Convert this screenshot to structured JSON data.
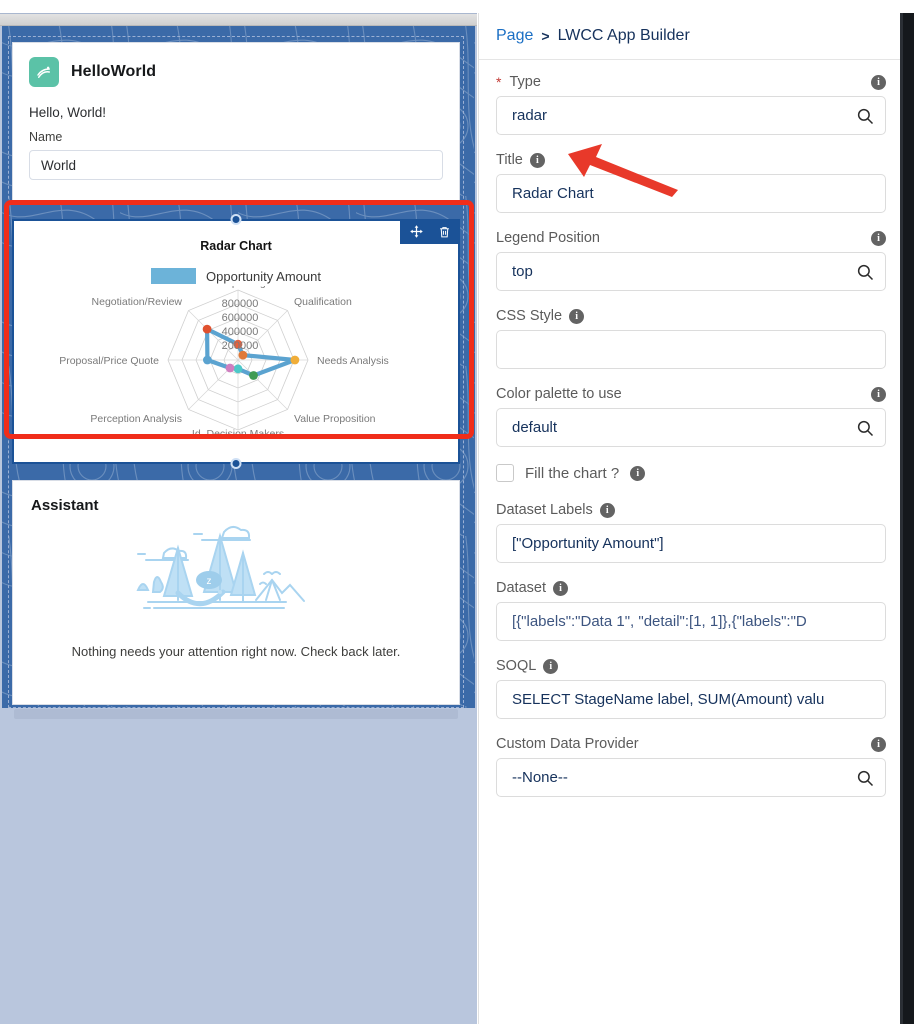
{
  "canvas": {
    "hello_card": {
      "icon": "lightning-component-icon",
      "title": "HelloWorld",
      "greeting": "Hello, World!",
      "field_label": "Name",
      "field_value": "World"
    },
    "chart_card": {
      "toolbar": {
        "move_icon": "move-drag-icon",
        "delete_icon": "trash-delete-icon"
      },
      "title": "Radar Chart",
      "legend_label": "Opportunity Amount",
      "legend_color": "#6cb3d9"
    },
    "assistant_card": {
      "title": "Assistant",
      "illustration": "sleeping-camper-illustration",
      "message": "Nothing needs your attention right now. Check back later."
    }
  },
  "chart_data": {
    "type": "radar",
    "title": "Radar Chart",
    "legend_position": "top",
    "series": [
      {
        "name": "Opportunity Amount",
        "color": "#6cb3d9",
        "values": [
          180000,
          80000,
          650000,
          250000,
          100000,
          130000,
          350000,
          500000
        ],
        "point_colors": [
          "#e8603c",
          "#e8a33d",
          "#f0ad38",
          "#3f9b53",
          "#4ec8c8",
          "#cf7fc0",
          "#5ba3d0",
          "#e0512f"
        ]
      }
    ],
    "categories": [
      "Prospecting",
      "Qualification",
      "Needs Analysis",
      "Value Proposition",
      "Id. Decision Makers",
      "Perception Analysis",
      "Proposal/Price Quote",
      "Negotiation/Review"
    ],
    "tick_labels": [
      "200000",
      "400000",
      "600000",
      "800000"
    ],
    "rmax": 800000,
    "grid": true,
    "legend": {
      "position": "top",
      "entries": [
        "Opportunity Amount"
      ]
    }
  },
  "panel": {
    "breadcrumb": {
      "parent": "Page",
      "separator": ">",
      "current": "LWCC App Builder"
    },
    "fields": {
      "type": {
        "label": "Type",
        "required_marker": "*",
        "value": "radar",
        "icon": "search-icon",
        "info_icon": "info-icon"
      },
      "title": {
        "label": "Title",
        "value": "Radar Chart",
        "info_icon": "info-icon"
      },
      "legend_position": {
        "label": "Legend Position",
        "value": "top",
        "icon": "search-icon",
        "info_icon": "info-icon"
      },
      "css_style": {
        "label": "CSS Style",
        "value": "",
        "info_icon": "info-icon"
      },
      "color_palette": {
        "label": "Color palette to use",
        "value": "default",
        "icon": "search-icon",
        "info_icon": "info-icon"
      },
      "fill_chart": {
        "label": "Fill the chart ?",
        "checked": false,
        "info_icon": "info-icon"
      },
      "dataset_labels": {
        "label": "Dataset Labels",
        "value": "[\"Opportunity Amount\"]",
        "info_icon": "info-icon"
      },
      "dataset": {
        "label": "Dataset",
        "value": "[{\"labels\":\"Data 1\", \"detail\":[1, 1]},{\"labels\":\"D",
        "info_icon": "info-icon"
      },
      "soql": {
        "label": "SOQL",
        "value": "SELECT StageName label, SUM(Amount) valu",
        "info_icon": "info-icon"
      },
      "custom_data_provider": {
        "label": "Custom Data Provider",
        "value": "--None--",
        "icon": "search-icon",
        "info_icon": "info-icon"
      }
    }
  },
  "annotation": {
    "highlight_color": "#f02d1a",
    "arrow_color": "#e8392a",
    "arrow_target": "type-field"
  }
}
